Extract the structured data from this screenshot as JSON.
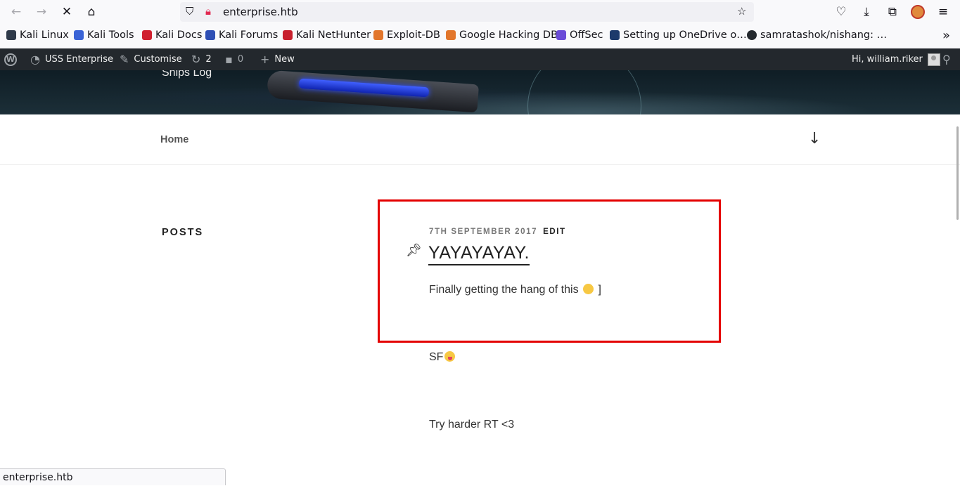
{
  "browser": {
    "url": "enterprise.htb",
    "icons": [
      "back-icon",
      "forward-icon",
      "stop-icon",
      "home-icon",
      "shield-icon",
      "lock-icon",
      "star-icon",
      "pocket-icon",
      "download-icon",
      "extensions-icon",
      "account-icon",
      "menu-icon"
    ]
  },
  "bookmarks": [
    {
      "label": "Kali Linux",
      "color": "#2f3a4a"
    },
    {
      "label": "Kali Tools",
      "color": "#3a63d6"
    },
    {
      "label": "Kali Docs",
      "color": "#d0202f"
    },
    {
      "label": "Kali Forums",
      "color": "#2e4fb5"
    },
    {
      "label": "Kali NetHunter",
      "color": "#c81f2d"
    },
    {
      "label": "Exploit-DB",
      "color": "#e2762c"
    },
    {
      "label": "Google Hacking DB",
      "color": "#e2762c"
    },
    {
      "label": "OffSec",
      "color": "#6a4bd8"
    },
    {
      "label": "Setting up OneDrive o…",
      "color": "#1d3a6b"
    },
    {
      "label": "samratashok/nishang: …",
      "color": "#24292e"
    }
  ],
  "adminbar": {
    "site": "USS Enterprise",
    "customise": "Customise",
    "updates": "2",
    "comments": "0",
    "new": "New",
    "greeting": "Hi, william.riker"
  },
  "site": {
    "description": "Ships Log",
    "nav_home": "Home"
  },
  "content": {
    "posts_heading": "POSTS",
    "post": {
      "date": "7TH SEPTEMBER 2017",
      "edit": "EDIT",
      "title": "YAYAYAYAY.",
      "body_before": "Finally getting the hang of this",
      "body_after": "]"
    },
    "post2": "SF",
    "post3": "Try harder RT <3"
  },
  "status": {
    "text": "enterprise.htb"
  },
  "colors": {
    "highlight": "#e40000",
    "adminbar": "#23282d"
  }
}
